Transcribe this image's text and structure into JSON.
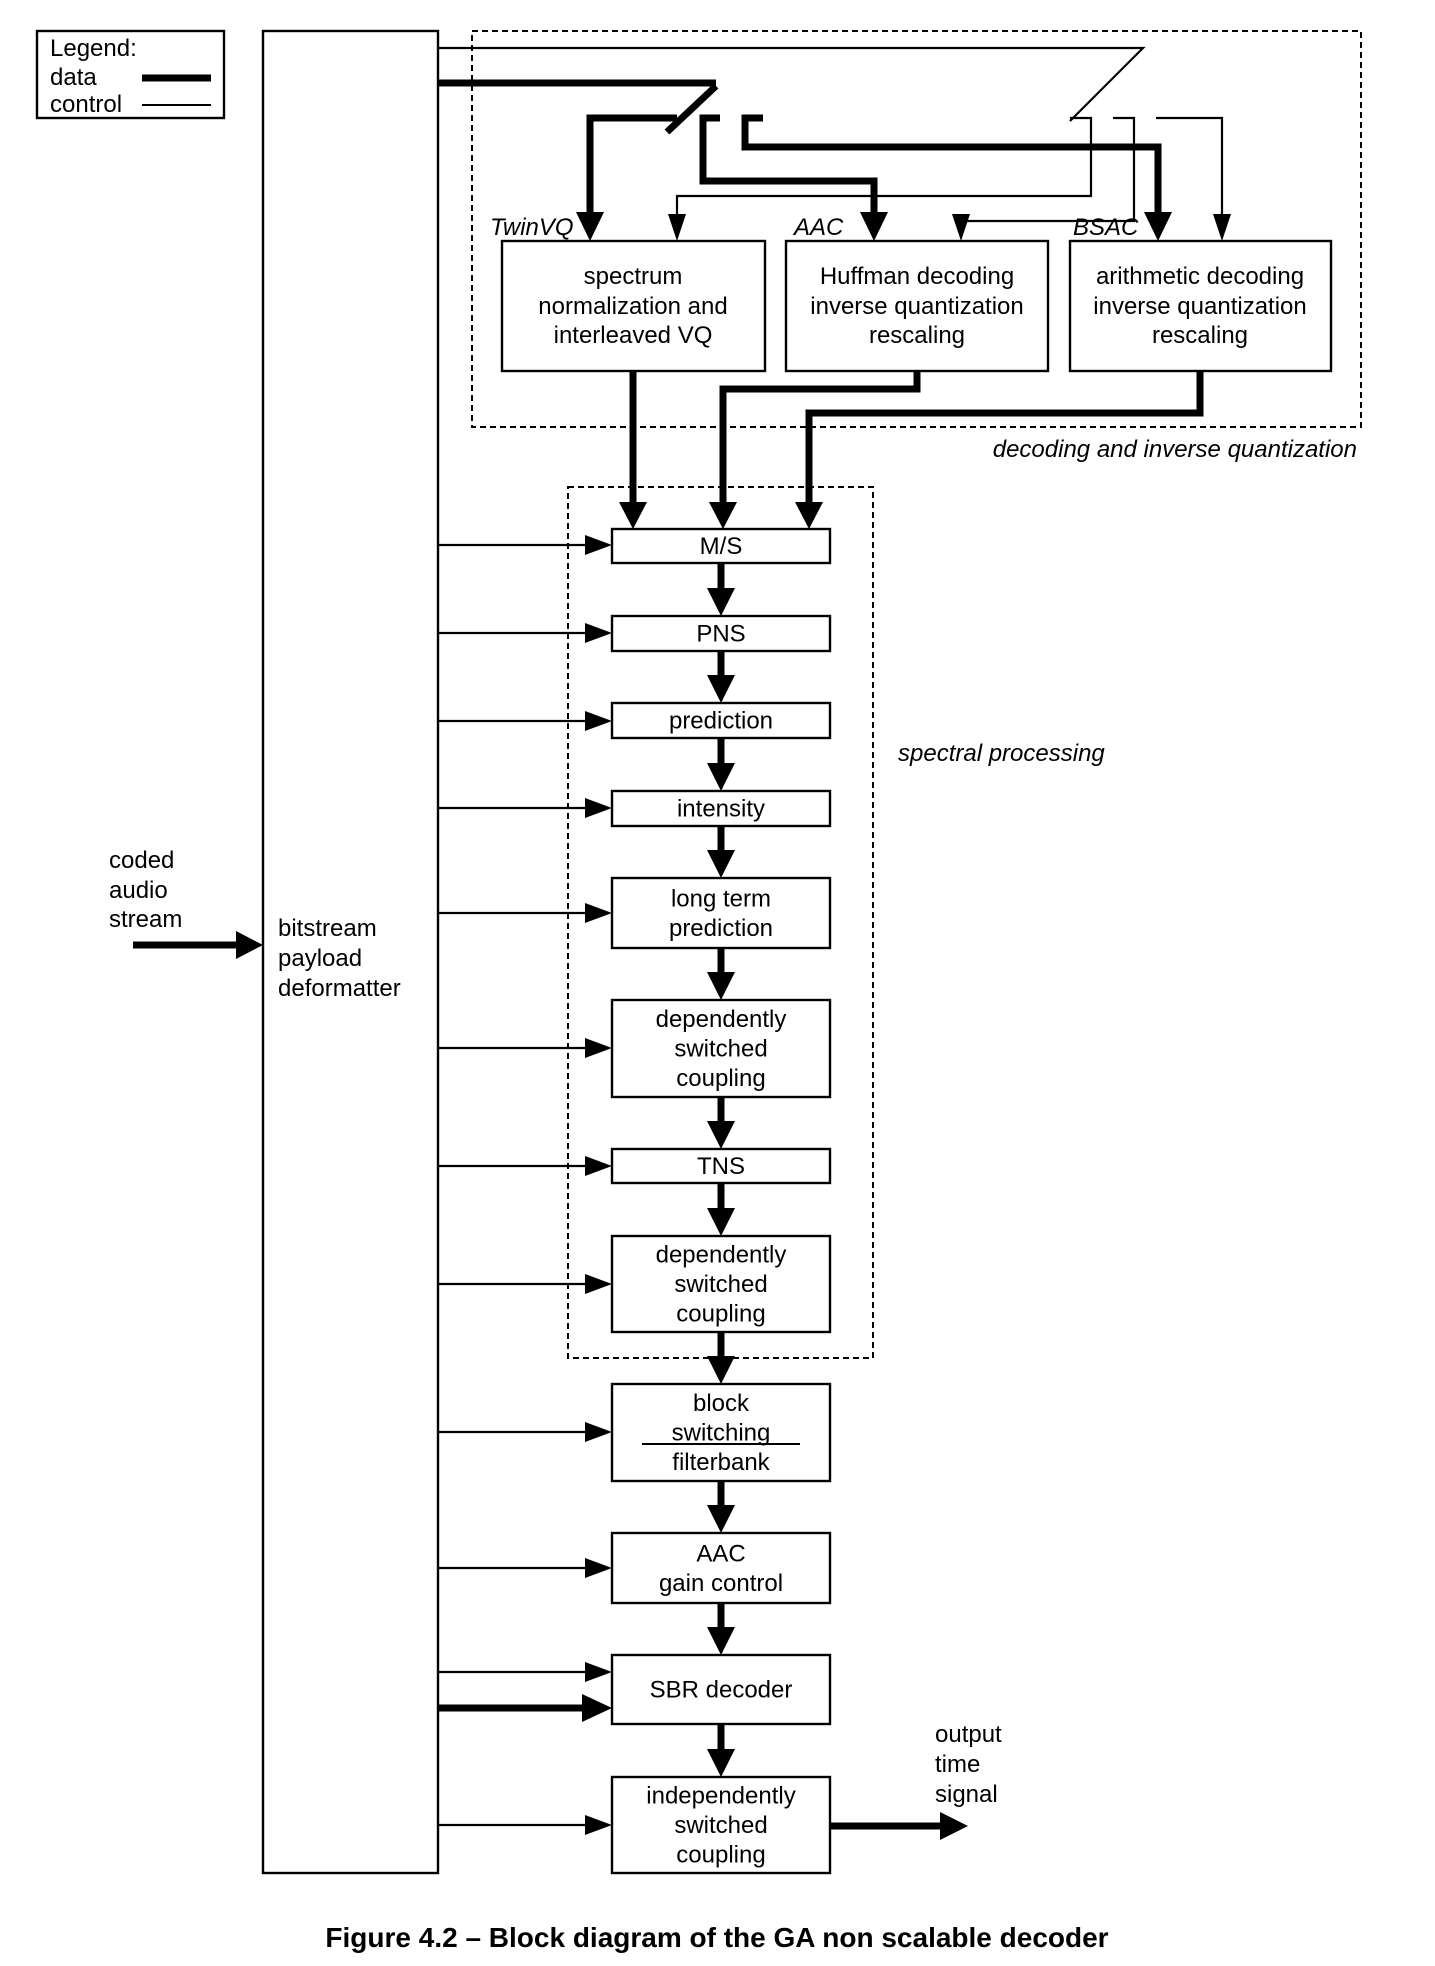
{
  "legend": {
    "title": "Legend:",
    "items": [
      {
        "label": "data",
        "style": "thick"
      },
      {
        "label": "control",
        "style": "thin"
      }
    ]
  },
  "input": {
    "lines": [
      "coded",
      "audio",
      "stream"
    ]
  },
  "deformatter": {
    "lines": [
      "bitstream",
      "payload",
      "deformatter"
    ]
  },
  "decoding_group": {
    "label": "decoding and inverse quantization",
    "tools": [
      {
        "tag": "TwinVQ",
        "lines": [
          "spectrum",
          "normalization and",
          "interleaved VQ"
        ]
      },
      {
        "tag": "AAC",
        "lines": [
          "Huffman decoding",
          "inverse quantization",
          "rescaling"
        ]
      },
      {
        "tag": "BSAC",
        "lines": [
          "arithmetic decoding",
          "inverse quantization",
          "rescaling"
        ]
      }
    ]
  },
  "spectral_group": {
    "label": "spectral processing",
    "blocks": [
      {
        "lines": [
          "M/S"
        ]
      },
      {
        "lines": [
          "PNS"
        ]
      },
      {
        "lines": [
          "prediction"
        ]
      },
      {
        "lines": [
          "intensity"
        ]
      },
      {
        "lines": [
          "long term",
          "prediction"
        ]
      },
      {
        "lines": [
          "dependently",
          "switched",
          "coupling"
        ]
      },
      {
        "lines": [
          "TNS"
        ]
      },
      {
        "lines": [
          "dependently",
          "switched",
          "coupling"
        ]
      }
    ]
  },
  "post_blocks": [
    {
      "lines": [
        "block",
        "switching",
        "filterbank"
      ]
    },
    {
      "lines": [
        "AAC",
        "gain control"
      ]
    },
    {
      "lines": [
        "SBR decoder"
      ]
    },
    {
      "lines": [
        "independently",
        "switched",
        "coupling"
      ]
    }
  ],
  "output": {
    "lines": [
      "output",
      "time",
      "signal"
    ]
  },
  "caption": "Figure 4.2 – Block diagram of the GA non scalable decoder"
}
